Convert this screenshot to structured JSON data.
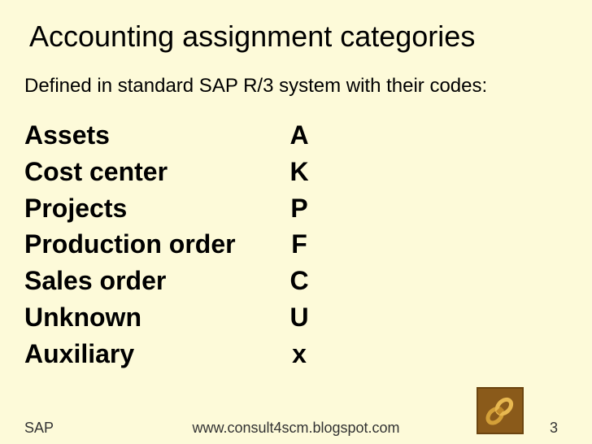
{
  "title": "Accounting assignment categories",
  "subtitle": "Defined in standard SAP R/3 system with their codes:",
  "categories": [
    {
      "name": "Assets",
      "code": "A"
    },
    {
      "name": "Cost center",
      "code": "K"
    },
    {
      "name": "Projects",
      "code": "P"
    },
    {
      "name": "Production order",
      "code": "F"
    },
    {
      "name": "Sales order",
      "code": "C"
    },
    {
      "name": "Unknown",
      "code": "U"
    },
    {
      "name": "Auxiliary",
      "code": "x"
    }
  ],
  "footer": {
    "left": "SAP",
    "center": "www.consult4scm.blogspot.com",
    "page": "3"
  }
}
